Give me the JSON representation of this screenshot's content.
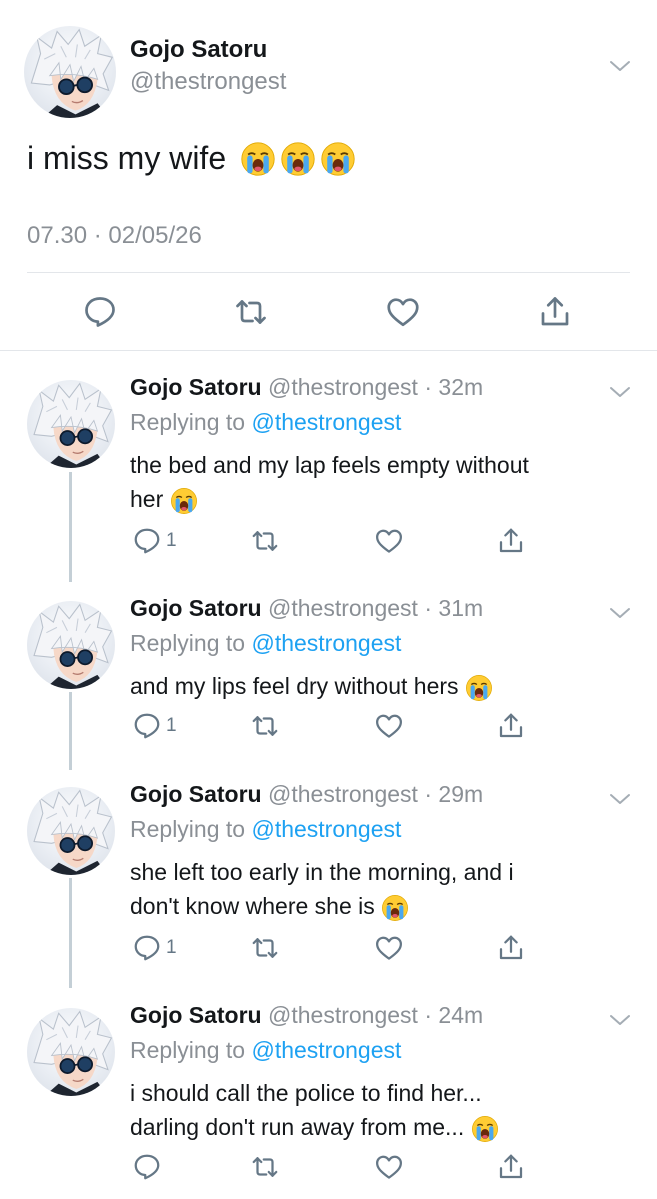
{
  "main_tweet": {
    "name": "Gojo Satoru",
    "handle": "@thestrongest",
    "text": "i miss my wife",
    "emojis": [
      "loudly-crying-face",
      "loudly-crying-face",
      "loudly-crying-face"
    ],
    "timestamp": "07.30 · 02/05/26",
    "actions": [
      "reply-icon",
      "retweet-icon",
      "like-icon",
      "share-icon"
    ]
  },
  "replies": [
    {
      "name": "Gojo Satoru",
      "handle": "@thestrongest",
      "time": "32m",
      "replying_prefix": "Replying to",
      "replying_to": "@thestrongest",
      "text_lines": [
        "the bed and my lap feels empty without",
        "her"
      ],
      "reply_count": "1"
    },
    {
      "name": "Gojo Satoru",
      "handle": "@thestrongest",
      "time": "31m",
      "replying_prefix": "Replying to",
      "replying_to": "@thestrongest",
      "text_lines": [
        "and my lips feel dry without hers"
      ],
      "reply_count": "1"
    },
    {
      "name": "Gojo Satoru",
      "handle": "@thestrongest",
      "time": "29m",
      "replying_prefix": "Replying to",
      "replying_to": "@thestrongest",
      "text_lines": [
        "she left too early in the morning, and i",
        "don't know where she is"
      ],
      "reply_count": "1"
    },
    {
      "name": "Gojo Satoru",
      "handle": "@thestrongest",
      "time": "24m",
      "replying_prefix": "Replying to",
      "replying_to": "@thestrongest",
      "text_lines": [
        "i should call the police to find her...",
        "darling don't run away from me..."
      ],
      "reply_count": ""
    }
  ],
  "colors": {
    "link": "#1da1f2",
    "muted": "#8a8f95",
    "icon": "#657786",
    "divider": "#e3e6ea",
    "thread": "#c4cfd6"
  }
}
